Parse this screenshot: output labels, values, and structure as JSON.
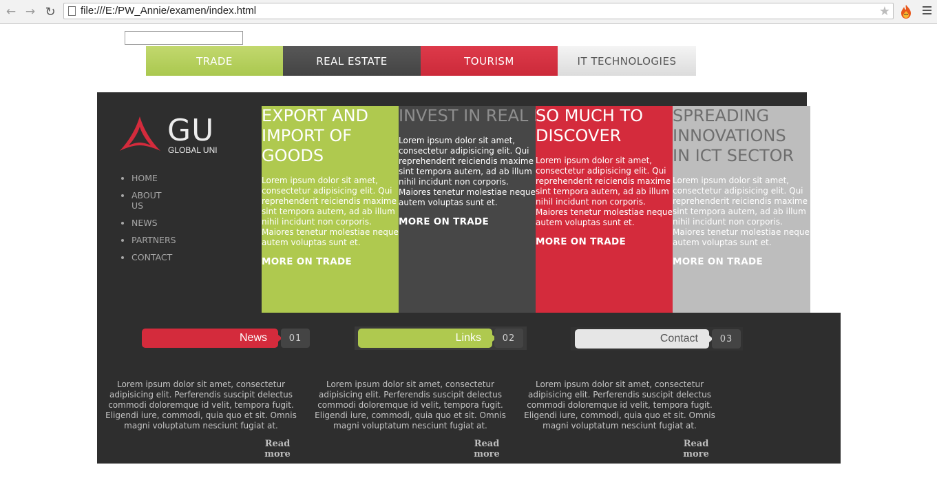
{
  "browser": {
    "url": "file:///E:/PW_Annie/examen/index.html",
    "back_icon": "back-arrow-icon",
    "forward_icon": "forward-arrow-icon",
    "reload_icon": "reload-icon"
  },
  "search": {
    "value": "",
    "placeholder": ""
  },
  "topnav": {
    "tabs": [
      {
        "label": "TRADE"
      },
      {
        "label": "REAL ESTATE"
      },
      {
        "label": "TOURISM"
      },
      {
        "label": "IT TECHNOLOGIES"
      }
    ]
  },
  "logo": {
    "mark": "GU",
    "subtitle": "GLOBAL UNI",
    "accent": "#d42b3c"
  },
  "sidemenu": {
    "items": [
      {
        "label": "HOME"
      },
      {
        "label": "ABOUT US"
      },
      {
        "label": "NEWS"
      },
      {
        "label": "PARTNERS"
      },
      {
        "label": "CONTACT"
      }
    ]
  },
  "columns": [
    {
      "title": "EXPORT AND\nIMPORT OF\nGOODS",
      "text": "Lorem ipsum dolor sit amet, consectetur adipisicing elit. Qui reprehenderit reiciendis maxime sint tempora autem, ad ab illum nihil incidunt non corporis. Maiores tenetur molestiae neque autem voluptas sunt et.",
      "more": "MORE ON TRADE",
      "color": "#afc94f"
    },
    {
      "title": "INVEST IN REAL\nESTATE IN\nGEORGIA",
      "text": "Lorem ipsum dolor sit amet, consectetur adipisicing elit. Qui reprehenderit reiciendis maxime sint tempora autem, ad ab illum nihil incidunt non corporis. Maiores tenetur molestiae neque autem voluptas sunt et.",
      "more": "MORE ON TRADE",
      "color": "#474747"
    },
    {
      "title": "SO MUCH TO\nDISCOVER",
      "text": "Lorem ipsum dolor sit amet, consectetur adipisicing elit. Qui reprehenderit reiciendis maxime sint tempora autem, ad ab illum nihil incidunt non corporis. Maiores tenetur molestiae neque autem voluptas sunt et.",
      "more": "MORE ON TRADE",
      "color": "#d42b3c"
    },
    {
      "title": "SPREADING\nINNOVATIONS\nIN ICT SECTOR",
      "text": "Lorem ipsum dolor sit amet, consectetur adipisicing elit. Qui reprehenderit reiciendis maxime sint tempora autem, ad ab illum nihil incidunt non corporis. Maiores tenetur molestiae neque autem voluptas sunt et.",
      "more": "MORE ON TRADE",
      "color": "#bdbdbd"
    }
  ],
  "sections": [
    {
      "label": "News",
      "number": "01"
    },
    {
      "label": "Links",
      "number": "02"
    },
    {
      "label": "Contact",
      "number": "03"
    }
  ],
  "blocks": [
    {
      "text": "Lorem ipsum dolor sit amet, consectetur adipisicing elit. Perferendis suscipit delectus commodi doloremque id velit, tempora fugit. Eligendi iure, commodi, quia quo et sit. Omnis magni voluptatum nesciunt fugiat at.",
      "readmore": "Read more"
    },
    {
      "text": "Lorem ipsum dolor sit amet, consectetur adipisicing elit. Perferendis suscipit delectus commodi doloremque id velit, tempora fugit. Eligendi iure, commodi, quia quo et sit. Omnis magni voluptatum nesciunt fugiat at.",
      "readmore": "Read more"
    },
    {
      "text": "Lorem ipsum dolor sit amet, consectetur adipisicing elit. Perferendis suscipit delectus commodi doloremque id velit, tempora fugit. Eligendi iure, commodi, quia quo et sit. Omnis magni voluptatum nesciunt fugiat at.",
      "readmore": "Read more"
    }
  ]
}
